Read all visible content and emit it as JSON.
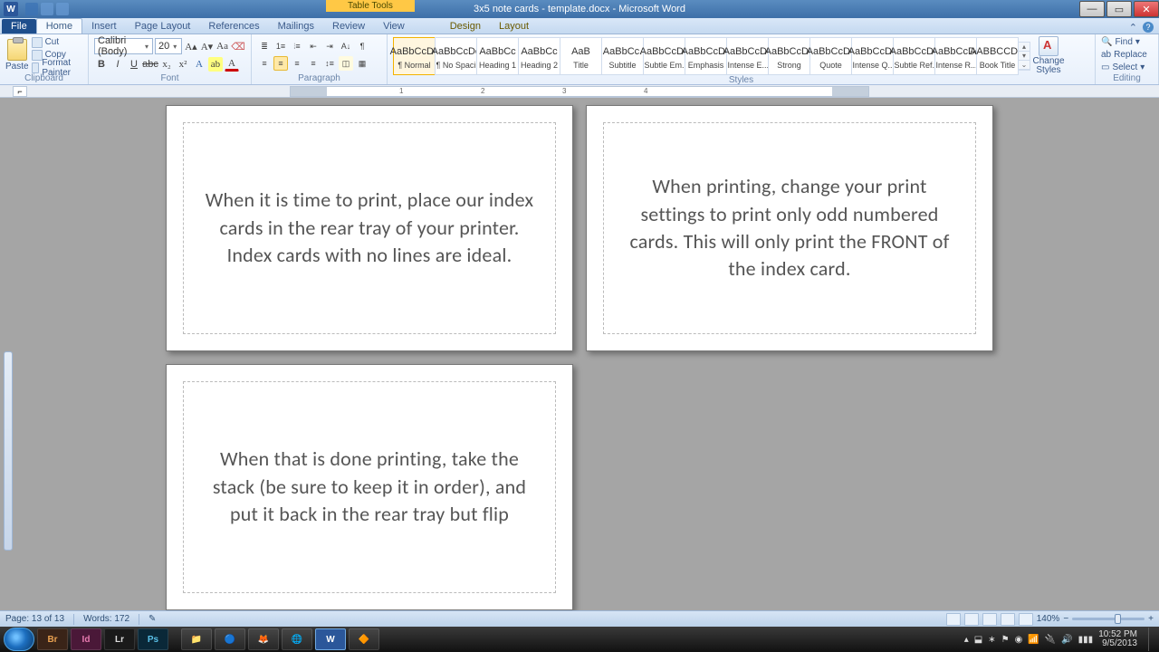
{
  "window": {
    "app": "Microsoft Word",
    "document": "3x5 note cards - template.docx",
    "title_display": "3x5 note cards - template.docx - Microsoft Word",
    "table_tools": "Table Tools"
  },
  "tabs": {
    "file": "File",
    "items": [
      "Home",
      "Insert",
      "Page Layout",
      "References",
      "Mailings",
      "Review",
      "View"
    ],
    "context": [
      "Design",
      "Layout"
    ],
    "active": "Home"
  },
  "ribbon": {
    "clipboard": {
      "label": "Clipboard",
      "paste": "Paste",
      "cut": "Cut",
      "copy": "Copy",
      "format_painter": "Format Painter"
    },
    "font": {
      "label": "Font",
      "name": "Calibri (Body)",
      "size": "20"
    },
    "paragraph": {
      "label": "Paragraph"
    },
    "styles": {
      "label": "Styles",
      "items": [
        {
          "preview": "AaBbCcDc",
          "name": "¶ Normal",
          "selected": true
        },
        {
          "preview": "AaBbCcDc",
          "name": "¶ No Spaci..."
        },
        {
          "preview": "AaBbCc",
          "name": "Heading 1"
        },
        {
          "preview": "AaBbCc",
          "name": "Heading 2"
        },
        {
          "preview": "AaB",
          "name": "Title"
        },
        {
          "preview": "AaBbCc.",
          "name": "Subtitle"
        },
        {
          "preview": "AaBbCcDc",
          "name": "Subtle Em..."
        },
        {
          "preview": "AaBbCcDc",
          "name": "Emphasis"
        },
        {
          "preview": "AaBbCcDc",
          "name": "Intense E..."
        },
        {
          "preview": "AaBbCcDc",
          "name": "Strong"
        },
        {
          "preview": "AaBbCcDc",
          "name": "Quote"
        },
        {
          "preview": "AaBbCcDc",
          "name": "Intense Q..."
        },
        {
          "preview": "AaBbCcDc",
          "name": "Subtle Ref..."
        },
        {
          "preview": "AaBbCcDc",
          "name": "Intense R..."
        },
        {
          "preview": "AABBCCDC",
          "name": "Book Title"
        }
      ],
      "change_styles": "Change Styles"
    },
    "editing": {
      "label": "Editing",
      "find": "Find",
      "replace": "Replace",
      "select": "Select"
    }
  },
  "cards": [
    "When it is time to print, place our index cards in the rear tray of your printer.  Index cards with no lines are ideal.",
    "When printing, change your print settings to print only odd numbered cards.  This will only print the FRONT of the index card.",
    "When that is done printing, take the stack (be sure to keep it in order), and put it back in the rear tray but flip"
  ],
  "status": {
    "page": "Page: 13 of 13",
    "words": "Words: 172",
    "zoom": "140%"
  },
  "taskbar": {
    "apps": [
      "Br",
      "Id",
      "Lr",
      "Ps",
      "",
      "",
      "",
      "",
      "",
      "W",
      ""
    ],
    "clock_time": "10:52 PM",
    "clock_date": "9/5/2013"
  }
}
